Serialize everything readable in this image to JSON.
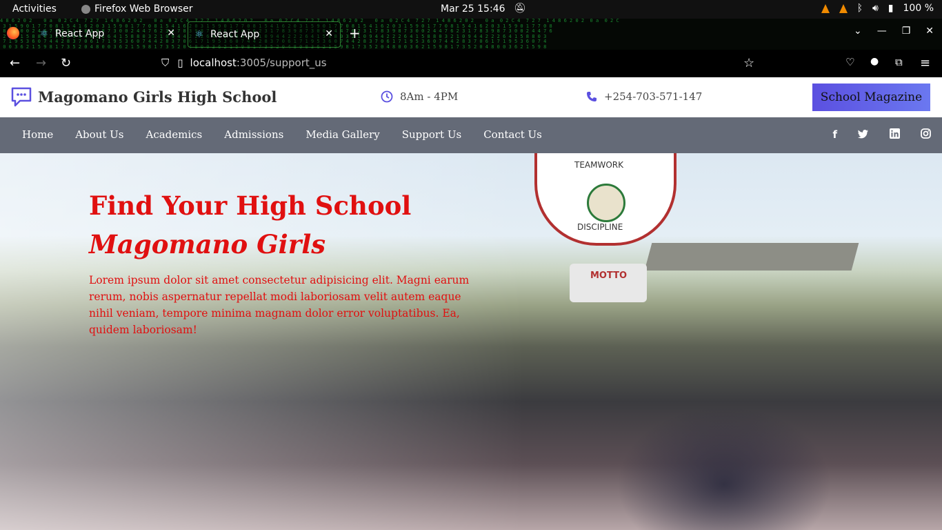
{
  "system": {
    "activities": "Activities",
    "app_name": "Firefox Web Browser",
    "datetime": "Mar 25  15:46",
    "battery": "100 %"
  },
  "browser": {
    "tabs": [
      {
        "title": "React App"
      },
      {
        "title": "React App"
      }
    ],
    "url_host": "localhost",
    "url_path": ":3005/support_us"
  },
  "site": {
    "name": "Magomano Girls High School",
    "hours": "8Am - 4PM",
    "phone": "+254-703-571-147",
    "magazine_button": "School Magazine",
    "nav": [
      "Home",
      "About Us",
      "Academics",
      "Admissions",
      "Media Gallery",
      "Support Us",
      "Contact Us"
    ],
    "social_icons": [
      "facebook-icon",
      "twitter-icon",
      "linkedin-icon",
      "instagram-icon"
    ]
  },
  "hero": {
    "heading": "Find Your High School",
    "subheading": "Magomano Girls",
    "text": "Lorem ipsum dolor sit amet consectetur adipisicing elit. Magni earum rerum, nobis aspernatur repellat modi laboriosam velit autem eaque nihil veniam, tempore minima magnam dolor error voluptatibus. Ea, quidem laboriosam!",
    "crest_top": "TEAMWORK",
    "crest_bottom": "DISCIPLINE",
    "sign": "MOTTO",
    "accent_color": "#e01010"
  }
}
